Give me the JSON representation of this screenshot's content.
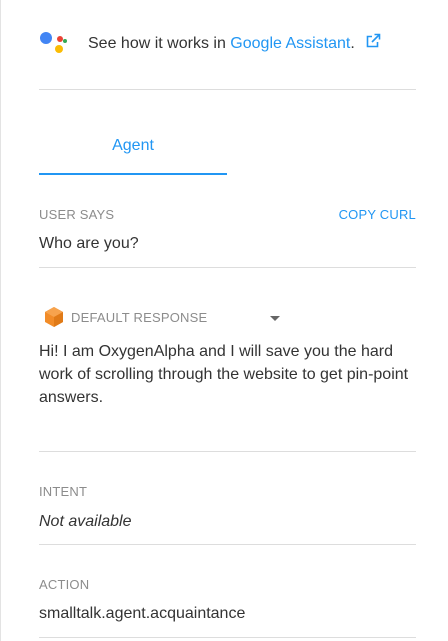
{
  "assistant": {
    "prefix": "See how it works in",
    "link": "Google Assistant",
    "suffix": ".",
    "icon": "external-link-icon"
  },
  "tabs": [
    {
      "label": "Agent",
      "active": true
    }
  ],
  "user_says": {
    "label": "USER SAYS",
    "copy_label": "COPY CURL",
    "value": "Who are you?"
  },
  "response": {
    "label": "DEFAULT RESPONSE",
    "icon": "default-response-cube-icon",
    "text": "Hi! I am OxygenAlpha and I will save you the hard work of scrolling through the website to get pin-point answers."
  },
  "intent": {
    "label": "INTENT",
    "value": "Not available"
  },
  "action": {
    "label": "ACTION",
    "value": "smalltalk.agent.acquaintance"
  },
  "colors": {
    "accent": "#2196f3",
    "cube": "#f28c28"
  }
}
